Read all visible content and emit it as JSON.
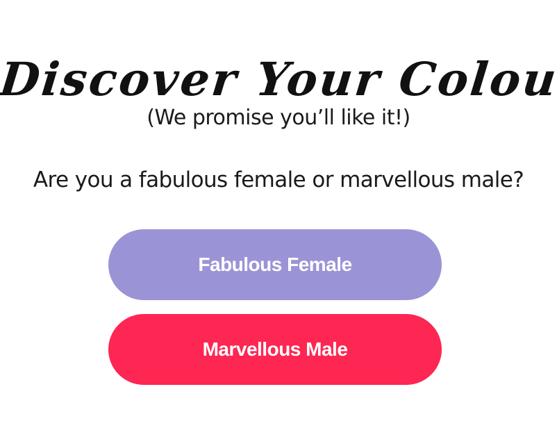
{
  "header": {
    "title": "Discover Your Colour",
    "subtitle": "(We promise you’ll like it!)"
  },
  "main": {
    "question": "Are you a fabulous female or marvellous male?",
    "buttons": [
      {
        "label": "Fabulous Female",
        "color": "#9a94d6"
      },
      {
        "label": "Marvellous Male",
        "color": "#fe2652"
      }
    ]
  },
  "colors": {
    "background": "#ffffff",
    "text": "#1a1a1a",
    "button_text": "#ffffff"
  }
}
